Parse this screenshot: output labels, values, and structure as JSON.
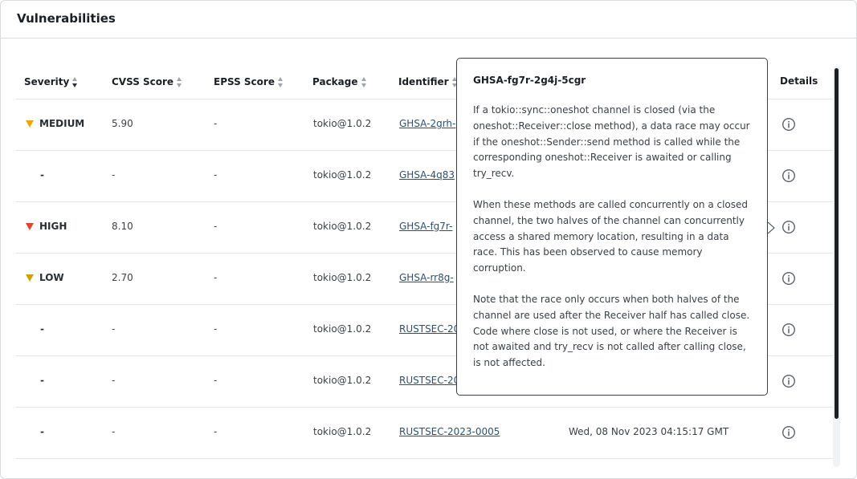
{
  "panel": {
    "title": "Vulnerabilities"
  },
  "columns": {
    "severity": "Severity",
    "cvss": "CVSS Score",
    "epss": "EPSS Score",
    "package": "Package",
    "identifier": "Identifier",
    "details": "Details"
  },
  "rows": [
    {
      "severity": "MEDIUM",
      "severity_level": "medium",
      "cvss": "5.90",
      "epss": "-",
      "package": "tokio@1.0.2",
      "identifier": "GHSA-2grh-",
      "date": ""
    },
    {
      "severity": "-",
      "severity_level": "none",
      "cvss": "-",
      "epss": "-",
      "package": "tokio@1.0.2",
      "identifier": "GHSA-4q83",
      "date": ""
    },
    {
      "severity": "HIGH",
      "severity_level": "high",
      "cvss": "8.10",
      "epss": "-",
      "package": "tokio@1.0.2",
      "identifier": "GHSA-fg7r-",
      "date": ""
    },
    {
      "severity": "LOW",
      "severity_level": "low",
      "cvss": "2.70",
      "epss": "-",
      "package": "tokio@1.0.2",
      "identifier": "GHSA-rr8g-",
      "date": ""
    },
    {
      "severity": "-",
      "severity_level": "none",
      "cvss": "-",
      "epss": "-",
      "package": "tokio@1.0.2",
      "identifier": "RUSTSEC-20",
      "date": ""
    },
    {
      "severity": "-",
      "severity_level": "none",
      "cvss": "-",
      "epss": "-",
      "package": "tokio@1.0.2",
      "identifier": "RUSTSEC-20",
      "date": ""
    },
    {
      "severity": "-",
      "severity_level": "none",
      "cvss": "-",
      "epss": "-",
      "package": "tokio@1.0.2",
      "identifier": "RUSTSEC-2023-0005",
      "date": "Wed, 08 Nov 2023 04:15:17 GMT"
    }
  ],
  "tooltip": {
    "title": "GHSA-fg7r-2g4j-5cgr",
    "paragraphs": [
      "If a tokio::sync::oneshot channel is closed (via the oneshot::Receiver::close method), a data race may occur if the oneshot::Sender::send method is called while the corresponding oneshot::Receiver is awaited or calling try_recv.",
      "When these methods are called concurrently on a closed channel, the two halves of the channel can concurrently access a shared memory location, resulting in a data race. This has been observed to cause memory corruption.",
      "Note that the race only occurs when both halves of the channel are used after the Receiver half has called close. Code where close is not used, or where the Receiver is not awaited and try_recv is not called after calling close, is not affected."
    ]
  },
  "colors": {
    "medium": "#e8a900",
    "high": "#e0432f",
    "low": "#c9a400",
    "link": "#2f4f6e"
  },
  "icons": {
    "details": "info-circle-icon",
    "sort": "sort-arrows-icon",
    "severity": "triangle-down-icon"
  }
}
